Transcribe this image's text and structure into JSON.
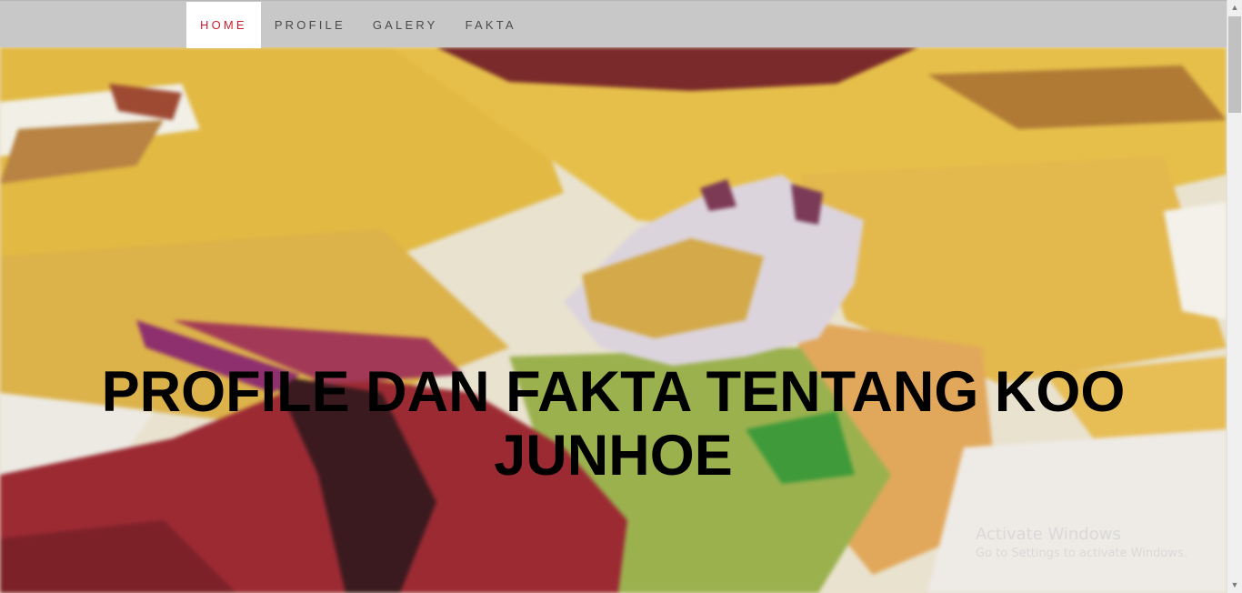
{
  "nav": {
    "items": [
      {
        "label": "HOME",
        "active": true
      },
      {
        "label": "PROFILE",
        "active": false
      },
      {
        "label": "GALERY",
        "active": false
      },
      {
        "label": "FAKTA",
        "active": false
      }
    ]
  },
  "hero": {
    "title_line1": "PROFILE DAN FAKTA TENTANG KOO",
    "title_line2": "JUNHOE"
  },
  "watermark": {
    "line1": "Activate Windows",
    "line2": "Go to Settings to activate Windows."
  },
  "colors": {
    "navbar_bg": "#c8c8c8",
    "active_text": "#cc1f2f",
    "nav_text": "#4a4a4a"
  }
}
